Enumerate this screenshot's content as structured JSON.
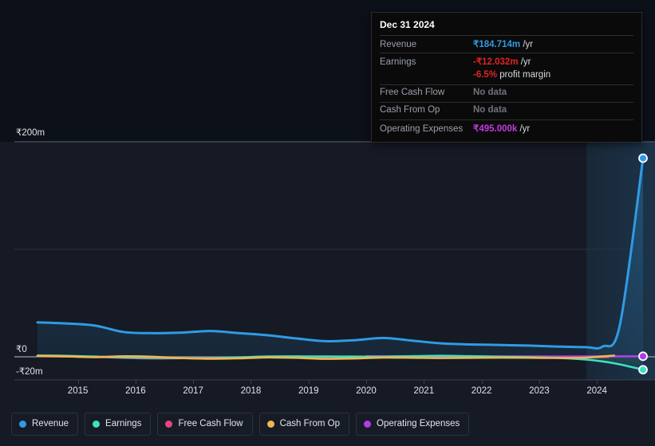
{
  "chart_data": {
    "type": "line",
    "title": "",
    "xlabel": "",
    "ylabel": "",
    "currency_symbol": "₹",
    "ylim": [
      -20000000,
      200000000
    ],
    "y_ticks": [
      {
        "label": "₹200m",
        "value": 200000000
      },
      {
        "label": "₹0",
        "value": 0
      },
      {
        "label": "-₹20m",
        "value": -20000000
      }
    ],
    "x_ticks": [
      "2015",
      "2016",
      "2017",
      "2018",
      "2019",
      "2020",
      "2021",
      "2022",
      "2023",
      "2024"
    ],
    "x_range": [
      "2014.3",
      "2025.0"
    ],
    "grid": true,
    "legend_position": "bottom-left",
    "highlight_band": {
      "from": "2024.0",
      "to": "2025.0",
      "label": "forecast/latest period"
    },
    "series": [
      {
        "name": "Revenue",
        "color": "#2f9be4",
        "area_fill": true,
        "end_marker": true,
        "x": [
          2014.3,
          2014.8,
          2015.3,
          2015.8,
          2016.3,
          2016.8,
          2017.3,
          2017.8,
          2018.3,
          2018.8,
          2019.3,
          2019.8,
          2020.3,
          2020.8,
          2021.3,
          2021.8,
          2022.3,
          2022.8,
          2023.3,
          2023.8,
          2024.1,
          2024.4,
          2024.8
        ],
        "values": [
          32.0,
          31.0,
          29.0,
          23.0,
          22.0,
          22.5,
          24.0,
          22.0,
          20.0,
          17.0,
          14.5,
          15.5,
          17.5,
          15.0,
          12.5,
          11.5,
          11.0,
          10.5,
          9.5,
          9.0,
          9.5,
          30.0,
          184.714
        ]
      },
      {
        "name": "Earnings",
        "color": "#3fe0c0",
        "end_marker": true,
        "x": [
          2014.3,
          2014.8,
          2015.3,
          2015.8,
          2016.3,
          2016.8,
          2017.3,
          2017.8,
          2018.3,
          2018.8,
          2019.3,
          2019.8,
          2020.3,
          2020.8,
          2021.3,
          2021.8,
          2022.3,
          2022.8,
          2023.3,
          2023.8,
          2024.3,
          2024.8
        ],
        "values": [
          1.2,
          0.9,
          0.2,
          -0.6,
          -1.0,
          -1.3,
          -1.2,
          -0.5,
          0.3,
          0.4,
          0.3,
          0.2,
          0.1,
          0.6,
          1.0,
          0.6,
          0.1,
          -0.3,
          -1.0,
          -2.5,
          -6.0,
          -12.032
        ]
      },
      {
        "name": "Free Cash Flow",
        "color": "#e8447f",
        "end_marker": false,
        "x": [
          2014.3,
          2015.3,
          2016.3,
          2017.3,
          2018.3,
          2019.3,
          2020.3,
          2021.3,
          2022.3,
          2023.3,
          2024.2
        ],
        "values": [
          0.6,
          -0.2,
          -1.5,
          -0.8,
          -0.4,
          -0.5,
          -0.6,
          -0.5,
          -0.4,
          -0.3,
          -0.2
        ]
      },
      {
        "name": "Cash From Op",
        "color": "#f0b64d",
        "end_marker": false,
        "x": [
          2014.3,
          2014.8,
          2015.3,
          2015.8,
          2016.3,
          2016.8,
          2017.3,
          2017.8,
          2018.3,
          2018.8,
          2019.3,
          2019.8,
          2020.3,
          2020.8,
          2021.3,
          2021.8,
          2022.3,
          2022.8,
          2023.3,
          2023.8,
          2024.3
        ],
        "values": [
          0.8,
          0.4,
          -0.3,
          0.5,
          0.1,
          -1.2,
          -1.8,
          -1.4,
          -0.6,
          -1.0,
          -1.9,
          -1.5,
          -0.7,
          -0.9,
          -1.2,
          -1.0,
          -0.8,
          -0.9,
          -1.1,
          -0.8,
          1.2
        ]
      },
      {
        "name": "Operating Expenses",
        "color": "#b03ce8",
        "end_marker": true,
        "x": [
          2020.0,
          2020.5,
          2021.0,
          2021.5,
          2022.0,
          2022.5,
          2023.0,
          2023.5,
          2024.0,
          2024.8
        ],
        "values": [
          0.5,
          0.45,
          0.4,
          0.4,
          0.38,
          0.36,
          0.35,
          0.36,
          0.42,
          0.495
        ]
      }
    ]
  },
  "tooltip": {
    "date": "Dec 31 2024",
    "rows": [
      {
        "key": "Revenue",
        "value": "₹184.714m",
        "unit": "/yr",
        "style": "revenue"
      },
      {
        "key": "Earnings",
        "value": "-₹12.032m",
        "unit": "/yr",
        "style": "negative"
      },
      {
        "key": "",
        "value": "-6.5%",
        "unit": "profit margin",
        "style": "negative"
      },
      {
        "key": "Free Cash Flow",
        "value": "No data",
        "unit": "",
        "style": "nodata"
      },
      {
        "key": "Cash From Op",
        "value": "No data",
        "unit": "",
        "style": "nodata"
      },
      {
        "key": "Operating Expenses",
        "value": "₹495.000k",
        "unit": "/yr",
        "style": "opex"
      }
    ]
  },
  "legend": {
    "items": [
      {
        "label": "Revenue",
        "color": "#2f9be4"
      },
      {
        "label": "Earnings",
        "color": "#3fe0c0"
      },
      {
        "label": "Free Cash Flow",
        "color": "#e8447f"
      },
      {
        "label": "Cash From Op",
        "color": "#f0b64d"
      },
      {
        "label": "Operating Expenses",
        "color": "#b03ce8"
      }
    ]
  }
}
